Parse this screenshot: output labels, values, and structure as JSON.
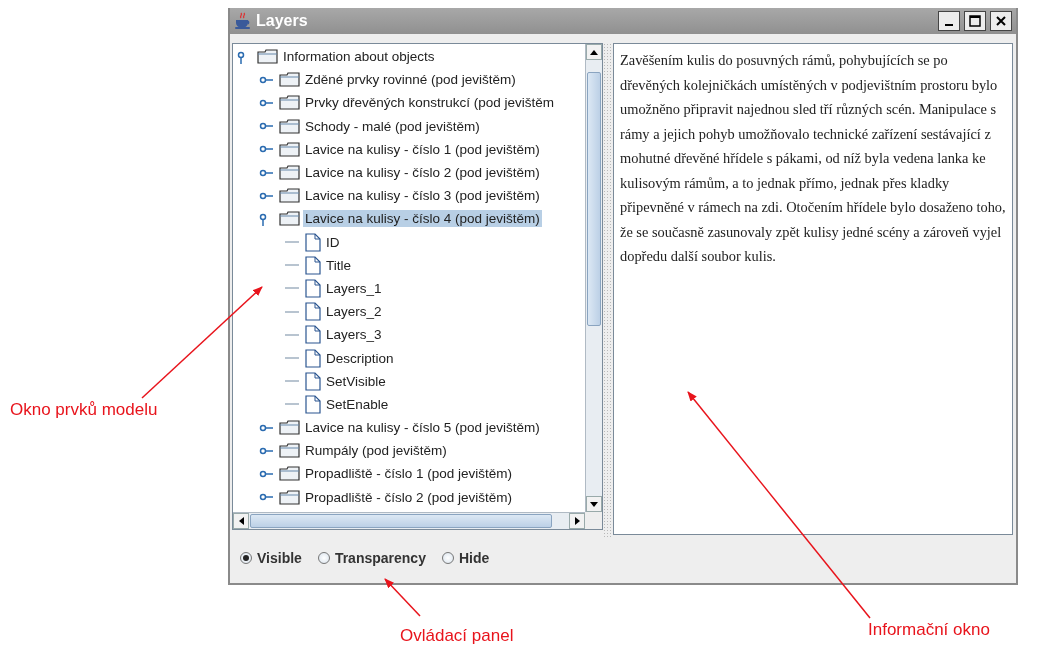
{
  "window": {
    "title": "Layers"
  },
  "tree": [
    {
      "label": "Information about objects",
      "kind": "folder",
      "expanded": true,
      "selected": false,
      "children": [
        {
          "label": "Zděné prvky rovinné (pod jevištěm)",
          "kind": "folder",
          "expanded": false,
          "selected": false
        },
        {
          "label": "Prvky dřevěných konstrukcí (pod jevištěm",
          "kind": "folder",
          "expanded": false,
          "selected": false
        },
        {
          "label": "Schody - malé (pod jevištěm)",
          "kind": "folder",
          "expanded": false,
          "selected": false
        },
        {
          "label": "Lavice na kulisy - číslo 1 (pod jevištěm)",
          "kind": "folder",
          "expanded": false,
          "selected": false
        },
        {
          "label": "Lavice na kulisy - číslo 2 (pod jevištěm)",
          "kind": "folder",
          "expanded": false,
          "selected": false
        },
        {
          "label": "Lavice na kulisy - číslo 3 (pod jevištěm)",
          "kind": "folder",
          "expanded": false,
          "selected": false
        },
        {
          "label": "Lavice na kulisy - číslo 4 (pod jevištěm)",
          "kind": "folder",
          "expanded": true,
          "selected": true,
          "children": [
            {
              "label": "ID",
              "kind": "file",
              "selected": false
            },
            {
              "label": "Title",
              "kind": "file",
              "selected": false
            },
            {
              "label": "Layers_1",
              "kind": "file",
              "selected": false
            },
            {
              "label": "Layers_2",
              "kind": "file",
              "selected": false
            },
            {
              "label": "Layers_3",
              "kind": "file",
              "selected": false
            },
            {
              "label": "Description",
              "kind": "file",
              "selected": false
            },
            {
              "label": "SetVisible",
              "kind": "file",
              "selected": false
            },
            {
              "label": "SetEnable",
              "kind": "file",
              "selected": false
            }
          ]
        },
        {
          "label": "Lavice na kulisy - číslo 5 (pod jevištěm)",
          "kind": "folder",
          "expanded": false,
          "selected": false
        },
        {
          "label": "Rumpály (pod jevištěm)",
          "kind": "folder",
          "expanded": false,
          "selected": false
        },
        {
          "label": "Propadliště - číslo 1 (pod jevištěm)",
          "kind": "folder",
          "expanded": false,
          "selected": false
        },
        {
          "label": "Propadliště - číslo 2 (pod jevištěm)",
          "kind": "folder",
          "expanded": false,
          "selected": false
        }
      ]
    }
  ],
  "info_text": "Zavěšením kulis do posuvných rámů, pohybujících se po dřevěných kolejničkách umístěných v podjevištním prostoru bylo umožněno připravit najednou sled tří různých scén. Manipulace s rámy a jejich pohyb umožňovalo technické zařízení sestávající z mohutné dřevěné hřídele s pákami, od níž byla vedena lanka ke kulisovým rámům, a to jednak přímo, jednak přes kladky připevněné v rámech na zdi. Otočením hřídele bylo dosaženo toho, že se současně zasunovaly zpět kulisy jedné scény a zároveň vyjel dopředu další soubor kulis.",
  "visibility_options": [
    {
      "label": "Visible",
      "selected": true
    },
    {
      "label": "Transparency",
      "selected": false
    },
    {
      "label": "Hide",
      "selected": false
    }
  ],
  "annotations": [
    {
      "label": "Okno prvků modelu"
    },
    {
      "label": "Ovládací panel"
    },
    {
      "label": "Informační okno"
    }
  ]
}
